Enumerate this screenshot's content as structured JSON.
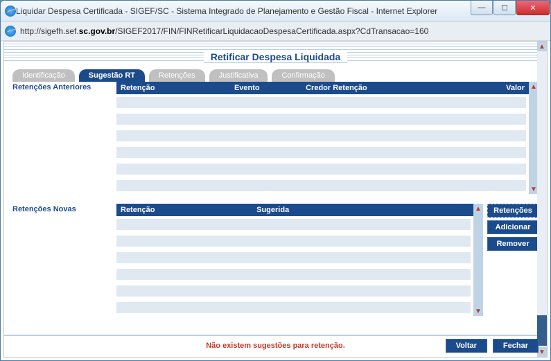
{
  "window": {
    "title": "Liquidar Despesa Certificada - SIGEF/SC - Sistema Integrado de Planejamento e Gestão Fiscal - Internet Explorer",
    "url_pre": "http://sigefh.sef.",
    "url_dom": "sc.gov.br",
    "url_post": "/SIGEF2017/FIN/FINRetificarLiquidacaoDespesaCertificada.aspx?CdTransacao=160"
  },
  "page": {
    "title": "Retificar Despesa Liquidada"
  },
  "tabs": {
    "identificacao": "Identificação",
    "sugestao_rt": "Sugestão RT",
    "retencoes": "Retenções",
    "justificativa": "Justificativa",
    "confirmacao": "Confirmação",
    "active": "sugestao_rt"
  },
  "sections": {
    "anteriores": {
      "label": "Retenções Anteriores",
      "cols": {
        "retencao": "Retenção",
        "evento": "Evento",
        "credor": "Credor Retenção",
        "valor": "Valor"
      }
    },
    "novas": {
      "label": "Retenções Novas",
      "cols": {
        "retencao": "Retenção",
        "sugerida": "Sugerida"
      }
    }
  },
  "buttons": {
    "retencoes": "Retenções",
    "adicionar": "Adicionar",
    "remover": "Remover",
    "voltar": "Voltar",
    "fechar": "Fechar"
  },
  "message": "Não existem sugestões para retenção."
}
